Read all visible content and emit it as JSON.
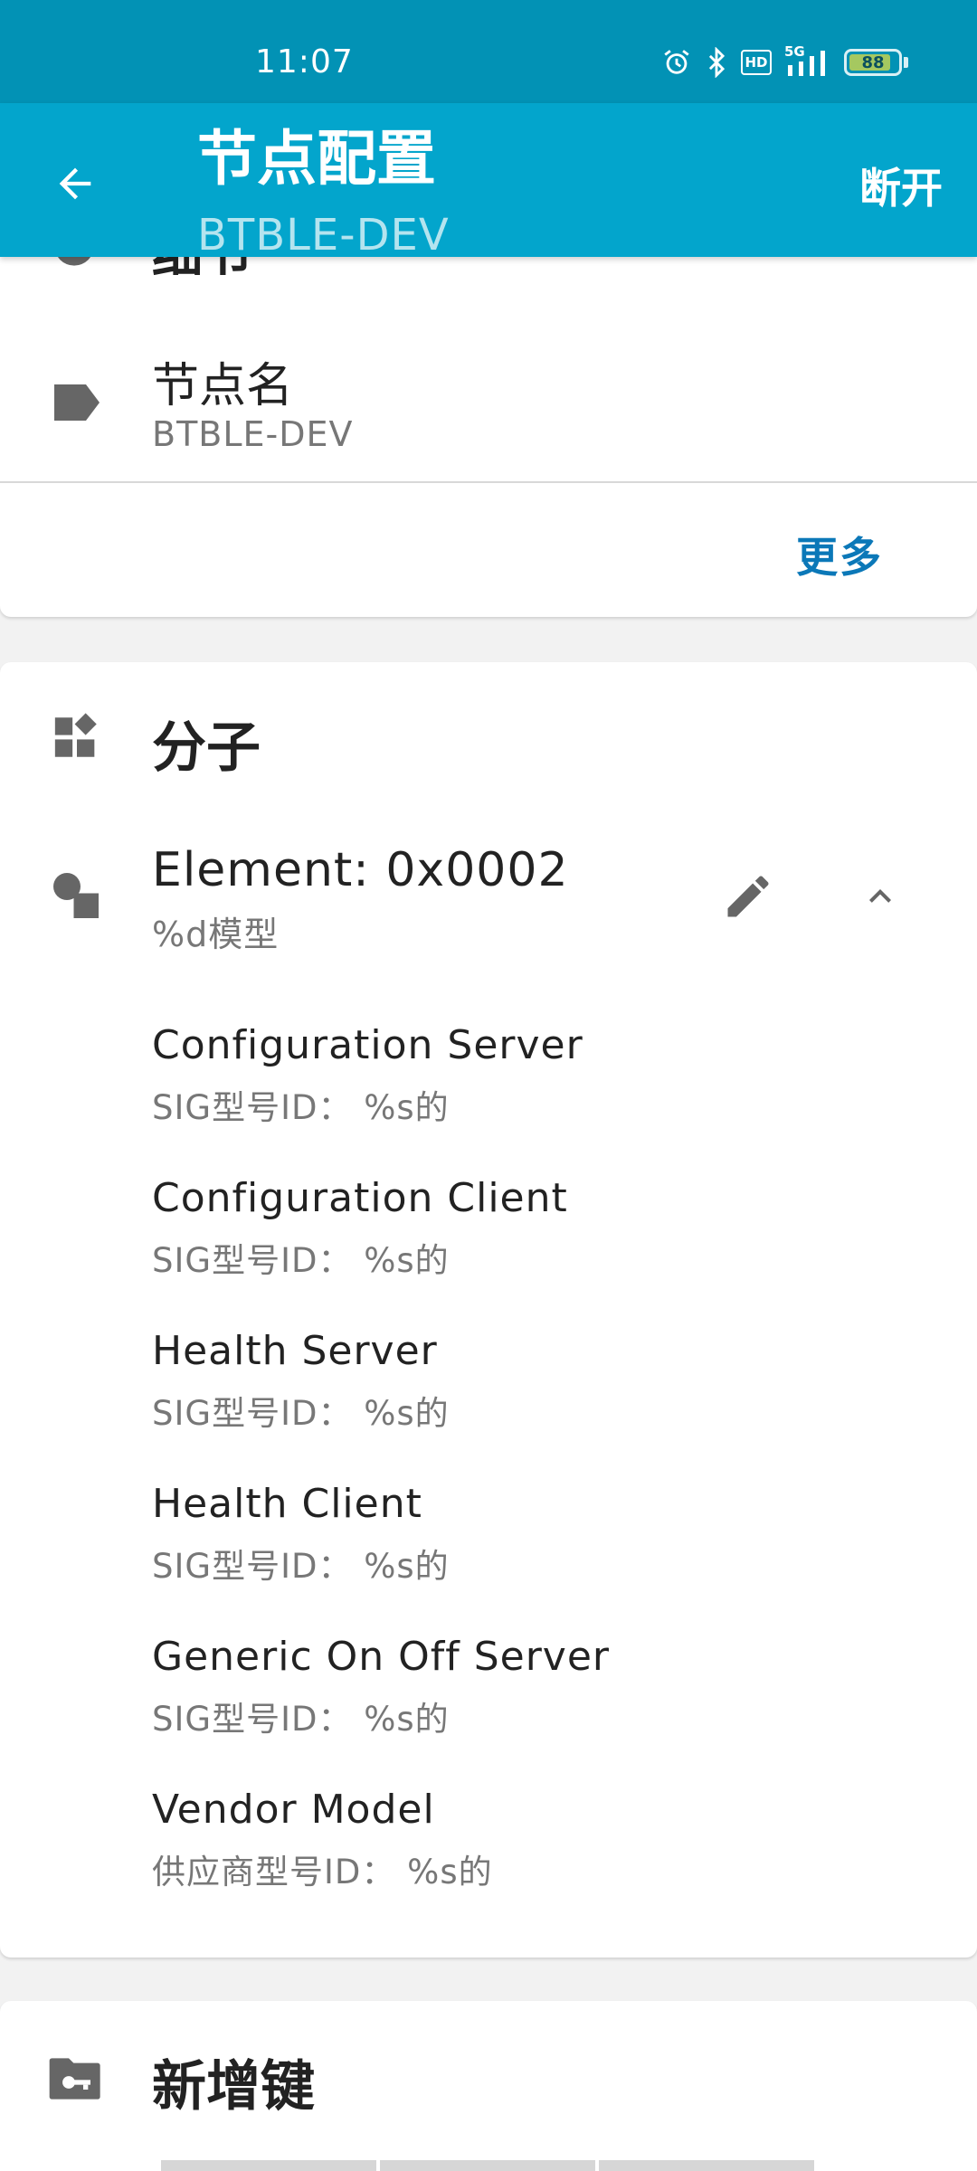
{
  "status_bar": {
    "time": "11:07",
    "network": "5G",
    "battery": "88",
    "hd_label": "HD"
  },
  "app_bar": {
    "title": "节点配置",
    "subtitle": "BTBLE-DEV",
    "disconnect_label": "断开"
  },
  "details_card": {
    "partial_header": "细节",
    "node_name_label": "节点名",
    "node_name_value": "BTBLE-DEV",
    "more_label": "更多"
  },
  "elements_card": {
    "title": "分子",
    "element_name": "Element: 0x0002",
    "element_models": "%d模型",
    "models": [
      {
        "name": "Configuration Server",
        "id": "SIG型号ID：  %s的"
      },
      {
        "name": "Configuration Client",
        "id": "SIG型号ID：  %s的"
      },
      {
        "name": "Health Server",
        "id": "SIG型号ID：  %s的"
      },
      {
        "name": "Health Client",
        "id": "SIG型号ID：  %s的"
      },
      {
        "name": "Generic On Off Server",
        "id": "SIG型号ID：  %s的"
      },
      {
        "name": "Vendor Model",
        "id": "供应商型号ID：  %s的"
      }
    ]
  },
  "keys_card": {
    "title": "新增键"
  },
  "colors": {
    "status_bar": "#0292b5",
    "app_bar": "#03a5cc",
    "accent_link": "#0b78b8",
    "icon_grey": "#666666"
  }
}
